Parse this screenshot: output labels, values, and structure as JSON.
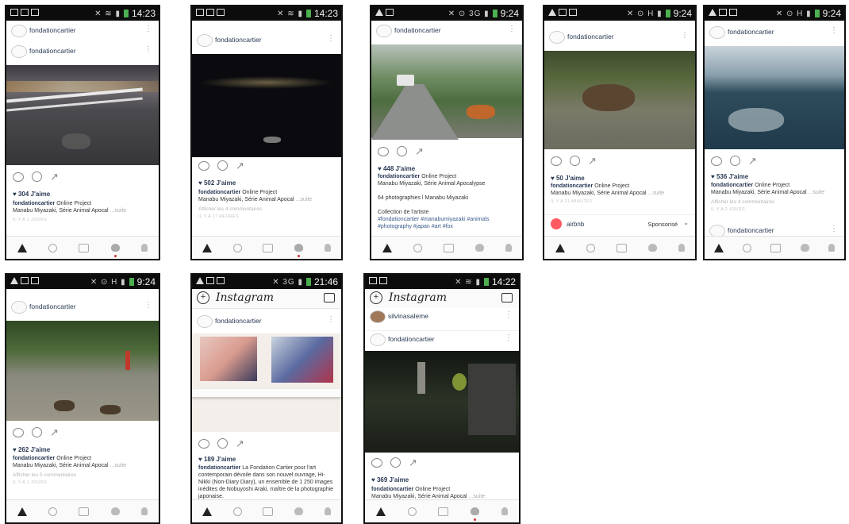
{
  "status_bars": {
    "p1": {
      "time": "14:23"
    },
    "p2": {
      "time": "14:23"
    },
    "p3": {
      "time": "9:24"
    },
    "p4": {
      "time": "9:24"
    },
    "p5": {
      "time": "9:24"
    },
    "p6": {
      "time": "9:24"
    },
    "p7": {
      "time": "21:46"
    },
    "p8": {
      "time": "14:22"
    }
  },
  "app": {
    "logo": "Instagram"
  },
  "accounts": {
    "main": "fondationcartier",
    "other": "silvinasaleme",
    "sponsor": "airbnb",
    "sponsored_label": "Sponsorisé"
  },
  "posts": {
    "p1": {
      "likes": "304 J'aime",
      "author": "fondationcartier",
      "caption": " Online Project",
      "caption2": "Manabu Miyazaki, Série Animal Apocal",
      "more": "...suite",
      "age": "IL Y A 1 JOURS"
    },
    "p2": {
      "likes": "502 J'aime",
      "author": "fondationcartier",
      "caption": " Online Project",
      "caption2": "Manabu Miyazaki, Série Animal Apocal",
      "more": "...suite",
      "comments": "Afficher les 4 commentaires",
      "age": "IL Y A 17 HEURES"
    },
    "p3": {
      "likes": "448 J'aime",
      "author": "fondationcartier",
      "caption": " Online Project",
      "caption2": "Manabu Miyazaki, Série Animal Apocalypse",
      "line3": "64 photographies l Manabu Miyazaki",
      "line4": "Collection de l'artiste",
      "tags": "#fondationcartier #manabumiyazaki #animals #photography #japan #art #fox"
    },
    "p4": {
      "likes": "50 J'aime",
      "author": "fondationcartier",
      "caption": " Online Project",
      "caption2": "Manabu Miyazaki, Série Animal Apocal",
      "more": "...suite",
      "age": "IL Y A 21 MINUTES"
    },
    "p5": {
      "likes": "536 J'aime",
      "author": "fondationcartier",
      "caption": " Online Project",
      "caption2": "Manabu Miyazaki, Série Animal Apocal",
      "more": "...suite",
      "comments": "Afficher les 4 commentaires",
      "age": "IL Y A 2 JOURS"
    },
    "p6": {
      "likes": "262 J'aime",
      "author": "fondationcartier",
      "caption": " Online Project",
      "caption2": "Manabu Miyazaki, Série Animal Apocal",
      "more": "...suite",
      "comments": "Afficher les 5 commentaires",
      "age": "IL Y A 1 JOURS"
    },
    "p7": {
      "likes": "189 J'aime",
      "author": "fondationcartier",
      "caption": " La Fondation Cartier pour l'art contemporain dévoile dans son nouvel ouvrage, Hi-Nikki (Non-Diary Diary), un ensemble de 1 250 images inédites de Nobuyoshi Araki, maître de la photographie japonaise."
    },
    "p8": {
      "likes": "369 J'aime",
      "author": "fondationcartier",
      "caption": " Online Project",
      "caption2": "Manabu Miyazaki, Série Animal Apocal",
      "more": "...suite"
    }
  },
  "colors": {
    "statusbar": "#0c0c0c",
    "username": "#2a3a55",
    "link": "#3b5d8c",
    "sponsor_avatar": "#ff5a5f"
  }
}
